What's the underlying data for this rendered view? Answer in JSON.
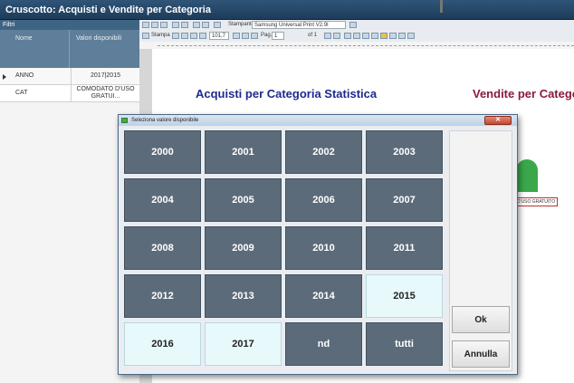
{
  "window": {
    "title": "Cruscotto: Acquisti e Vendite per Categoria"
  },
  "filters": {
    "caption": "Filtri",
    "col_name": "Nome",
    "col_values": "Valori disponibili",
    "rows": [
      {
        "name": "ANNO",
        "value": "2017|2015"
      },
      {
        "name": "CAT",
        "value": "COMODATO D'USO GRATUI..."
      }
    ]
  },
  "toolbar": {
    "printer_label": "Stampante",
    "printer_value": "Samsung Universal Print V2.9I",
    "print_label": "Stampa",
    "zoom_value": "101,7",
    "page_label": "Pag.",
    "page_value": "1",
    "page_of": "of 1"
  },
  "report": {
    "title_left": "Acquisti per Categoria Statistica",
    "title_right": "Vendite per Catego",
    "gauge_tag": "D'USO GRATUITO"
  },
  "dialog": {
    "title": "Seleziona valore disponibile",
    "close_label": "✕",
    "values": [
      "2000",
      "2001",
      "2002",
      "2003",
      "2004",
      "2005",
      "2006",
      "2007",
      "2008",
      "2009",
      "2010",
      "2011",
      "2012",
      "2013",
      "2014",
      "2015",
      "2016",
      "2017",
      "nd",
      "tutti"
    ],
    "selected": [
      "2015",
      "2016",
      "2017"
    ],
    "ok_label": "Ok",
    "cancel_label": "Annulla"
  },
  "colors": {
    "tile": "#5c6b79",
    "tile_selected": "#e8f9fb",
    "title_blue": "#1e2a8f",
    "title_red": "#8b1a3b",
    "gauge": "#3aa84a"
  }
}
